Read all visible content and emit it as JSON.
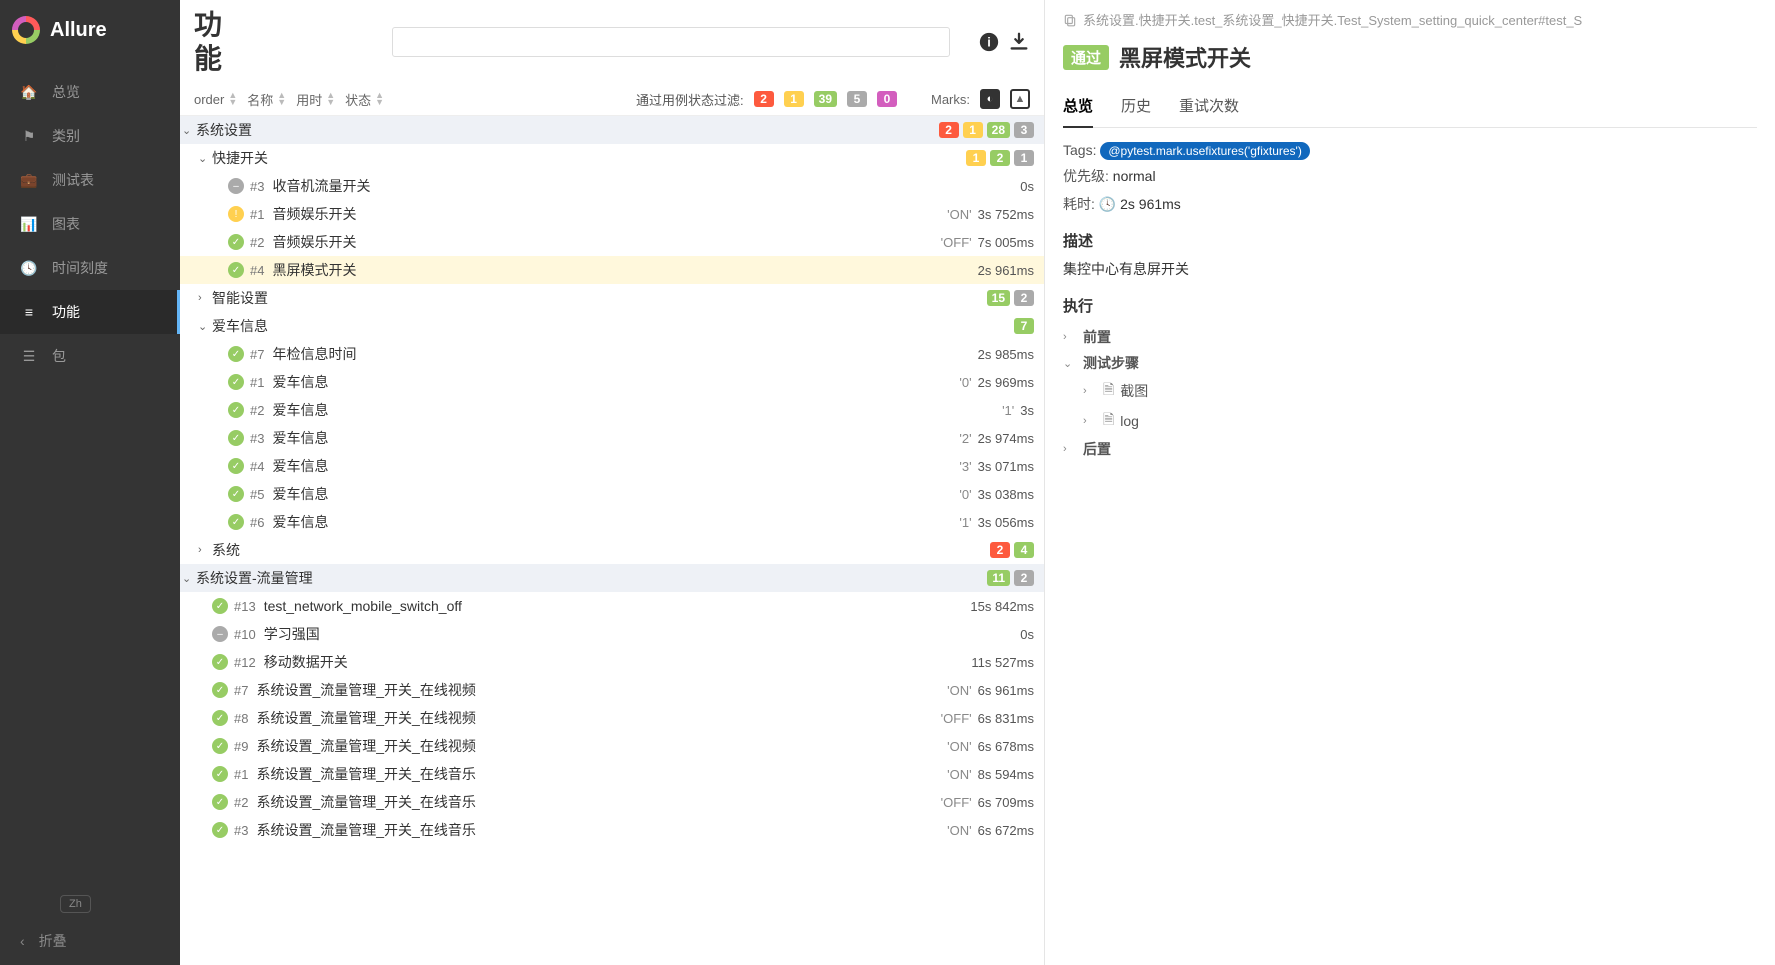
{
  "brand": "Allure",
  "sidebar": {
    "items": [
      {
        "icon": "home",
        "label": "总览"
      },
      {
        "icon": "flag",
        "label": "类别"
      },
      {
        "icon": "briefcase",
        "label": "测试表"
      },
      {
        "icon": "chart",
        "label": "图表"
      },
      {
        "icon": "clock",
        "label": "时间刻度"
      },
      {
        "icon": "list",
        "label": "功能"
      },
      {
        "icon": "bars",
        "label": "包"
      }
    ],
    "lang": "Zh",
    "collapse": "折叠"
  },
  "header": {
    "title": "功能"
  },
  "sorters": {
    "order": "order",
    "name": "名称",
    "duration": "用时",
    "status": "状态",
    "filter_label": "通过用例状态过滤:",
    "counts": {
      "fail": "2",
      "broken": "1",
      "pass": "39",
      "skip": "5",
      "unknown": "0"
    },
    "marks_label": "Marks:"
  },
  "tree": [
    {
      "type": "group",
      "level": 0,
      "open": true,
      "name": "系统设置",
      "badges": [
        [
          "b-red",
          "2"
        ],
        [
          "b-yel",
          "1"
        ],
        [
          "b-grn",
          "28"
        ],
        [
          "b-gry",
          "3"
        ]
      ]
    },
    {
      "type": "group",
      "level": 1,
      "open": true,
      "name": "快捷开关",
      "badges": [
        [
          "b-yel",
          "1"
        ],
        [
          "b-grn",
          "2"
        ],
        [
          "b-gry",
          "1"
        ]
      ]
    },
    {
      "type": "case",
      "level": 2,
      "status": "skip",
      "id": "#3",
      "name": "收音机流量开关",
      "param": "",
      "dur": "0s"
    },
    {
      "type": "case",
      "level": 2,
      "status": "broke",
      "id": "#1",
      "name": "音频娱乐开关",
      "param": "'ON'",
      "dur": "3s 752ms"
    },
    {
      "type": "case",
      "level": 2,
      "status": "pass",
      "id": "#2",
      "name": "音频娱乐开关",
      "param": "'OFF'",
      "dur": "7s 005ms"
    },
    {
      "type": "case",
      "level": 2,
      "status": "pass",
      "id": "#4",
      "name": "黑屏模式开关",
      "param": "",
      "dur": "2s 961ms",
      "selected": true
    },
    {
      "type": "group",
      "level": 1,
      "open": false,
      "name": "智能设置",
      "badges": [
        [
          "b-grn",
          "15"
        ],
        [
          "b-gry",
          "2"
        ]
      ]
    },
    {
      "type": "group",
      "level": 1,
      "open": true,
      "name": "爱车信息",
      "badges": [
        [
          "b-grn",
          "7"
        ]
      ]
    },
    {
      "type": "case",
      "level": 2,
      "status": "pass",
      "id": "#7",
      "name": "年检信息时间",
      "param": "",
      "dur": "2s 985ms"
    },
    {
      "type": "case",
      "level": 2,
      "status": "pass",
      "id": "#1",
      "name": "爱车信息",
      "param": "'0'",
      "dur": "2s 969ms"
    },
    {
      "type": "case",
      "level": 2,
      "status": "pass",
      "id": "#2",
      "name": "爱车信息",
      "param": "'1'",
      "dur": "3s"
    },
    {
      "type": "case",
      "level": 2,
      "status": "pass",
      "id": "#3",
      "name": "爱车信息",
      "param": "'2'",
      "dur": "2s 974ms"
    },
    {
      "type": "case",
      "level": 2,
      "status": "pass",
      "id": "#4",
      "name": "爱车信息",
      "param": "'3'",
      "dur": "3s 071ms"
    },
    {
      "type": "case",
      "level": 2,
      "status": "pass",
      "id": "#5",
      "name": "爱车信息",
      "param": "'0'",
      "dur": "3s 038ms"
    },
    {
      "type": "case",
      "level": 2,
      "status": "pass",
      "id": "#6",
      "name": "爱车信息",
      "param": "'1'",
      "dur": "3s 056ms"
    },
    {
      "type": "group",
      "level": 1,
      "open": false,
      "name": "系统",
      "badges": [
        [
          "b-red",
          "2"
        ],
        [
          "b-grn",
          "4"
        ]
      ]
    },
    {
      "type": "group",
      "level": 0,
      "open": true,
      "name": "系统设置-流量管理",
      "badges": [
        [
          "b-grn",
          "11"
        ],
        [
          "b-gry",
          "2"
        ]
      ]
    },
    {
      "type": "case",
      "level": 1,
      "status": "pass",
      "id": "#13",
      "name": "test_network_mobile_switch_off",
      "param": "",
      "dur": "15s 842ms"
    },
    {
      "type": "case",
      "level": 1,
      "status": "skip",
      "id": "#10",
      "name": "学习强国",
      "param": "",
      "dur": "0s"
    },
    {
      "type": "case",
      "level": 1,
      "status": "pass",
      "id": "#12",
      "name": "移动数据开关",
      "param": "",
      "dur": "11s 527ms"
    },
    {
      "type": "case",
      "level": 1,
      "status": "pass",
      "id": "#7",
      "name": "系统设置_流量管理_开关_在线视频",
      "param": "'ON'",
      "dur": "6s 961ms"
    },
    {
      "type": "case",
      "level": 1,
      "status": "pass",
      "id": "#8",
      "name": "系统设置_流量管理_开关_在线视频",
      "param": "'OFF'",
      "dur": "6s 831ms"
    },
    {
      "type": "case",
      "level": 1,
      "status": "pass",
      "id": "#9",
      "name": "系统设置_流量管理_开关_在线视频",
      "param": "'ON'",
      "dur": "6s 678ms"
    },
    {
      "type": "case",
      "level": 1,
      "status": "pass",
      "id": "#1",
      "name": "系统设置_流量管理_开关_在线音乐",
      "param": "'ON'",
      "dur": "8s 594ms"
    },
    {
      "type": "case",
      "level": 1,
      "status": "pass",
      "id": "#2",
      "name": "系统设置_流量管理_开关_在线音乐",
      "param": "'OFF'",
      "dur": "6s 709ms"
    },
    {
      "type": "case",
      "level": 1,
      "status": "pass",
      "id": "#3",
      "name": "系统设置_流量管理_开关_在线音乐",
      "param": "'ON'",
      "dur": "6s 672ms"
    }
  ],
  "detail": {
    "crumb": "系统设置.快捷开关.test_系统设置_快捷开关.Test_System_setting_quick_center#test_S",
    "status": "通过",
    "title": "黑屏模式开关",
    "tabs": [
      "总览",
      "历史",
      "重试次数"
    ],
    "tags_label": "Tags:",
    "tag": "@pytest.mark.usefixtures('gfixtures')",
    "priority_label": "优先级:",
    "priority": "normal",
    "duration_label": "耗时:",
    "duration": "2s 961ms",
    "desc_h": "描述",
    "desc": "集控中心有息屏开关",
    "exec_h": "执行",
    "before": "前置",
    "steps_h": "测试步骤",
    "steps": [
      "截图",
      "log"
    ],
    "after": "后置"
  }
}
